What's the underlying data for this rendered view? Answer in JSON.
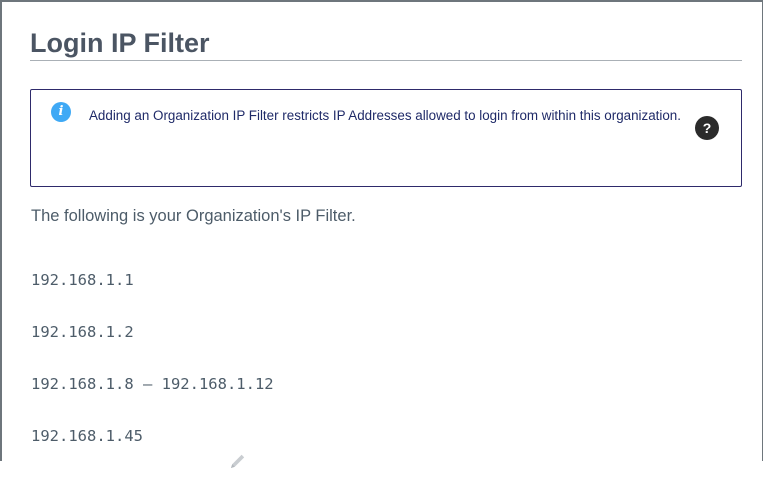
{
  "section": {
    "title": "Login IP Filter"
  },
  "notice": {
    "icon": "info-icon",
    "icon_glyph": "i",
    "text": "Adding an Organization IP Filter restricts IP Addresses allowed to login from within this organization.",
    "help_icon": "question-circle-icon",
    "help_glyph": "?",
    "border_color": "#2e2a6b",
    "icon_color": "#3fa9f5"
  },
  "intro_text": "The following is your Organization's IP Filter.",
  "ip_filters": [
    {
      "value": "192.168.1.1"
    },
    {
      "value": "192.168.1.2"
    },
    {
      "value": "192.168.1.8 – 192.168.1.12"
    },
    {
      "value": "192.168.1.45",
      "edit_icon": "pencil-icon"
    }
  ]
}
